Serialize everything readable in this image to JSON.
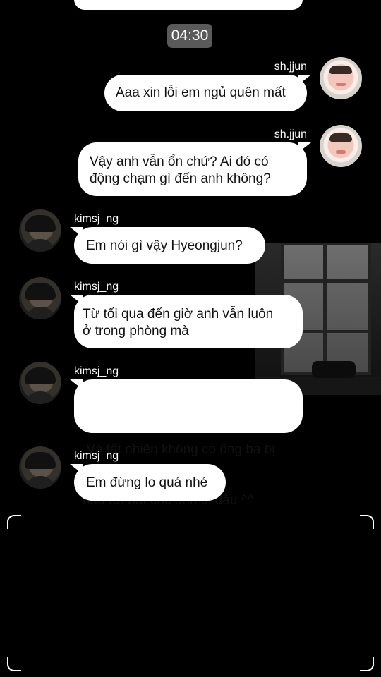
{
  "time_label": "04:30",
  "messages": [
    {
      "sender": "sh.jjun",
      "text": "Aaa xin lỗi em ngủ quên mất"
    },
    {
      "sender": "sh.jjun",
      "line1": "Vậy anh vẫn ổn chứ? Ai đó có",
      "line2": "động chạm gì đến anh không?"
    },
    {
      "sender": "kimsj_ng",
      "text": "Em nói gì vậy Hyeongjun?"
    },
    {
      "sender": "kimsj_ng",
      "line1": "Từ tối qua đến giờ anh vẫn luôn",
      "line2": "ở trong phòng mà"
    },
    {
      "sender": "kimsj_ng",
      "line1": " Và tất nhiên không có ông ba bị",
      "line2": "nào tới bắt cóc anh đi đâu ^^"
    },
    {
      "sender": "kimsj_ng",
      "text": "Em đừng lo quá nhé"
    }
  ]
}
